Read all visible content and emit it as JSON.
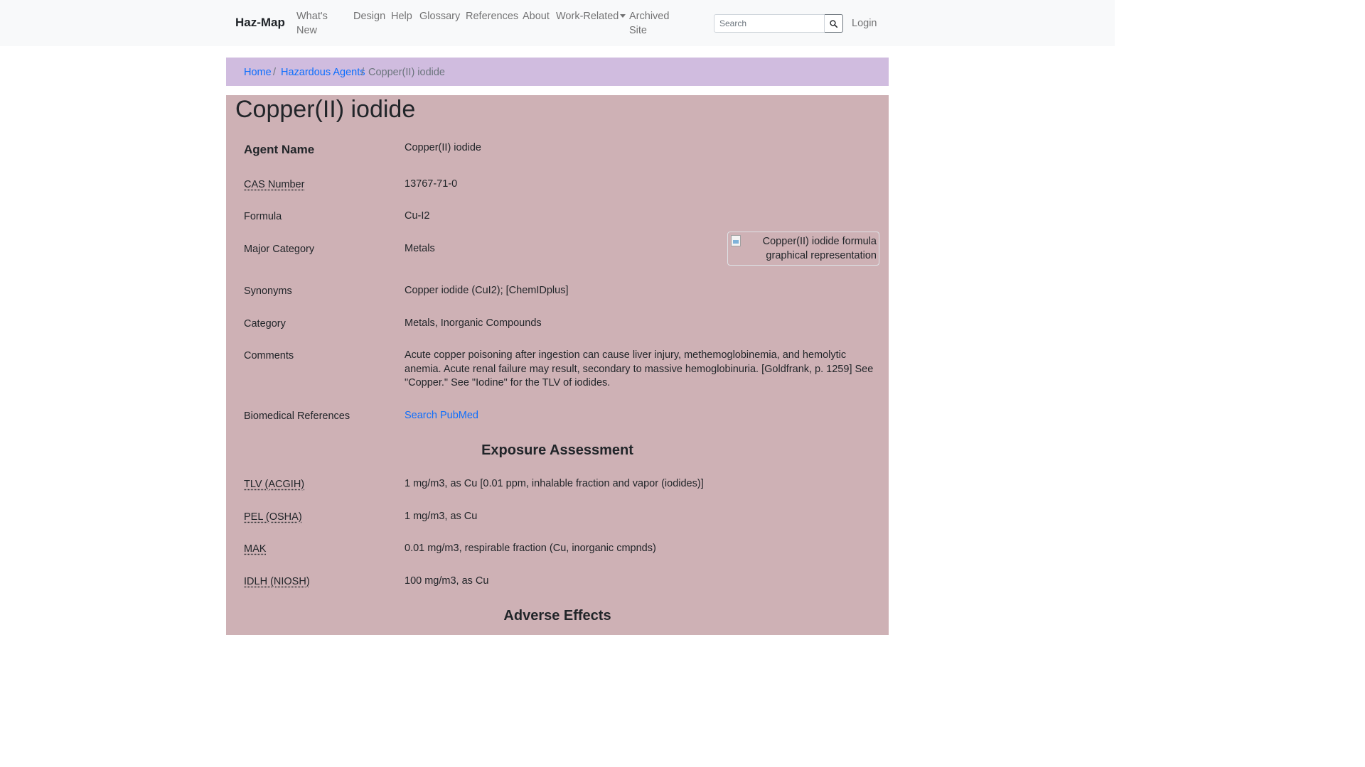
{
  "navbar": {
    "brand": "Haz-Map",
    "items": [
      {
        "label_line1": "What's",
        "label_line2": "New"
      },
      {
        "label": "Design"
      },
      {
        "label": "Help"
      },
      {
        "label": "Glossary"
      },
      {
        "label": "References"
      },
      {
        "label": "About"
      },
      {
        "label": "Work-Related"
      },
      {
        "label_line1": "Archived",
        "label_line2": "Site"
      }
    ],
    "search_placeholder": "Search",
    "login": "Login"
  },
  "breadcrumb": {
    "home": "Home",
    "sep": "/",
    "parent": "Hazardous Agents",
    "current": "Copper(II) iodide"
  },
  "page": {
    "title": "Copper(II) iodide",
    "formula_image_alt": "Copper(II) iodide formula graphical representation"
  },
  "fields": {
    "agent_name": {
      "label": "Agent Name",
      "value": "Copper(II) iodide"
    },
    "cas_number": {
      "label": "CAS Number",
      "value": "13767-71-0"
    },
    "formula": {
      "label": "Formula",
      "value": "Cu-I2"
    },
    "major_category": {
      "label": "Major Category",
      "value": "Metals"
    },
    "synonyms": {
      "label": "Synonyms",
      "value": "Copper iodide (CuI2); [ChemIDplus]"
    },
    "category": {
      "label": "Category",
      "value": "Metals, Inorganic Compounds"
    },
    "comments": {
      "label": "Comments",
      "value": "Acute copper poisoning after ingestion can cause liver injury, methemoglobinemia, and hemolytic anemia. Acute renal failure may result, secondary to massive hemoglobinuria. [Goldfrank, p. 1259] See \"Copper.\" See \"Iodine\" for the TLV of iodides."
    },
    "biomedical_references": {
      "label": "Biomedical References",
      "link": "Search PubMed"
    }
  },
  "exposure": {
    "heading": "Exposure Assessment",
    "tlv": {
      "label": "TLV (ACGIH)",
      "value": "1 mg/m3, as Cu [0.01 ppm, inhalable fraction and vapor (iodides)]"
    },
    "pel": {
      "label": "PEL (OSHA)",
      "value": "1 mg/m3, as Cu"
    },
    "mak": {
      "label": "MAK",
      "value": "0.01 mg/m3, respirable fraction (Cu, inorganic cmpnds)"
    },
    "idlh": {
      "label": "IDLH (NIOSH)",
      "value": "100 mg/m3, as Cu"
    }
  },
  "adverse": {
    "heading": "Adverse Effects"
  }
}
